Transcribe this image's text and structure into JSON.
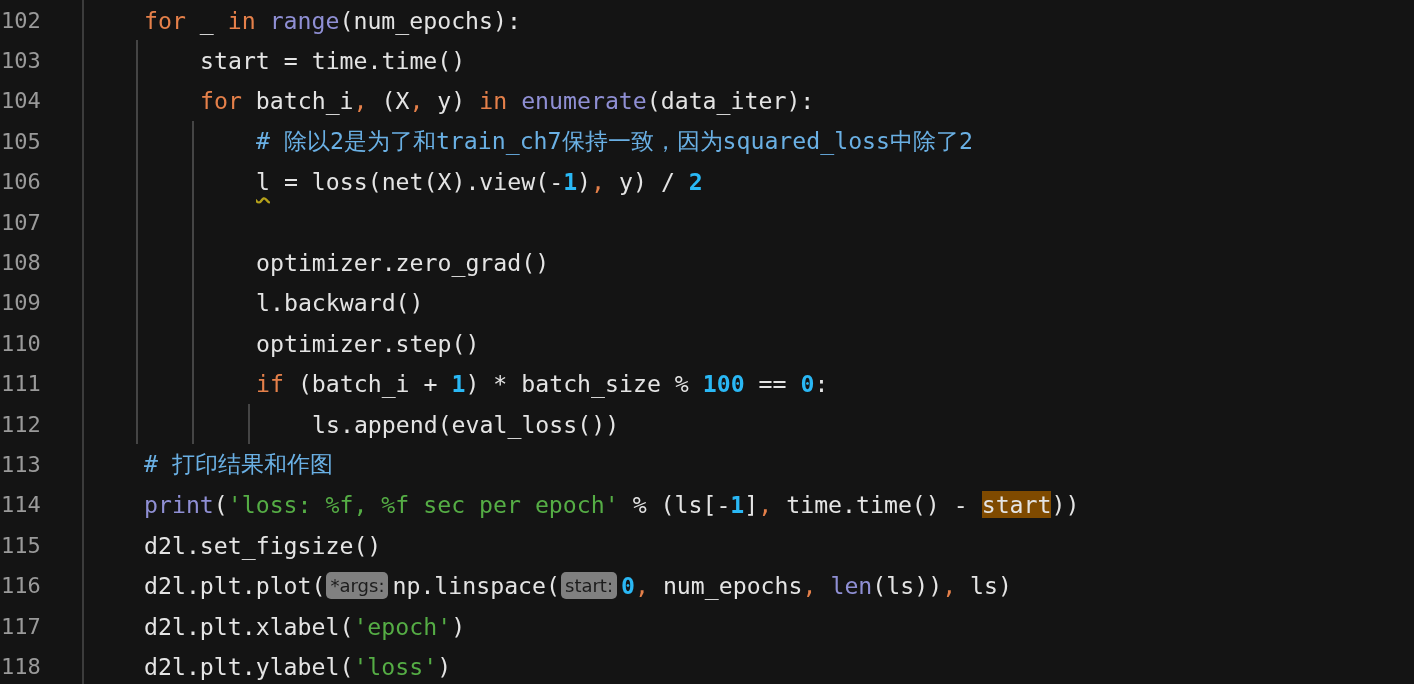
{
  "editor": {
    "lines": [
      {
        "number": "102",
        "tokens": [
          {
            "text": "for",
            "kind": "keyword"
          },
          {
            "text": " _ ",
            "kind": "plain"
          },
          {
            "text": "in",
            "kind": "keyword"
          },
          {
            "text": " range",
            "kind": "builtin"
          },
          {
            "text": "(num_epochs):",
            "kind": "plain"
          }
        ],
        "children": [
          {
            "number": "103",
            "tokens": [
              {
                "text": "start = time.time()",
                "kind": "plain"
              }
            ]
          },
          {
            "number": "104",
            "tokens": [
              {
                "text": "for",
                "kind": "keyword"
              },
              {
                "text": " batch_i",
                "kind": "plain"
              },
              {
                "text": ",",
                "kind": "punct"
              },
              {
                "text": " (X",
                "kind": "plain"
              },
              {
                "text": ",",
                "kind": "punct"
              },
              {
                "text": " y) ",
                "kind": "plain"
              },
              {
                "text": "in",
                "kind": "keyword"
              },
              {
                "text": " enumerate",
                "kind": "builtin"
              },
              {
                "text": "(data_iter):",
                "kind": "plain"
              }
            ],
            "children": [
              {
                "number": "105",
                "tokens": [
                  {
                    "text": "# 除以2是为了和train_ch7保持一致，因为squared_loss中除了2",
                    "kind": "comment"
                  }
                ]
              },
              {
                "number": "106",
                "tokens": [
                  {
                    "text": "l",
                    "kind": "warned"
                  },
                  {
                    "text": " = loss(net(X).view(-",
                    "kind": "plain"
                  },
                  {
                    "text": "1",
                    "kind": "number"
                  },
                  {
                    "text": ")",
                    "kind": "plain"
                  },
                  {
                    "text": ",",
                    "kind": "punct"
                  },
                  {
                    "text": " y) / ",
                    "kind": "plain"
                  },
                  {
                    "text": "2",
                    "kind": "number"
                  }
                ]
              },
              {
                "number": "107"
              },
              {
                "number": "108",
                "tokens": [
                  {
                    "text": "optimizer.zero_grad()",
                    "kind": "plain"
                  }
                ]
              },
              {
                "number": "109",
                "tokens": [
                  {
                    "text": "l.backward()",
                    "kind": "plain"
                  }
                ]
              },
              {
                "number": "110",
                "tokens": [
                  {
                    "text": "optimizer.step()",
                    "kind": "plain"
                  }
                ]
              },
              {
                "number": "111",
                "tokens": [
                  {
                    "text": "if",
                    "kind": "keyword"
                  },
                  {
                    "text": " (batch_i + ",
                    "kind": "plain"
                  },
                  {
                    "text": "1",
                    "kind": "number"
                  },
                  {
                    "text": ") * batch_size % ",
                    "kind": "plain"
                  },
                  {
                    "text": "100",
                    "kind": "number"
                  },
                  {
                    "text": " == ",
                    "kind": "plain"
                  },
                  {
                    "text": "0",
                    "kind": "number"
                  },
                  {
                    "text": ":",
                    "kind": "plain"
                  }
                ],
                "children": [
                  {
                    "number": "112",
                    "tokens": [
                      {
                        "text": "ls.append(eval_loss())",
                        "kind": "plain"
                      }
                    ]
                  }
                ]
              }
            ]
          }
        ]
      },
      {
        "number": "113",
        "tokens": [
          {
            "text": "# 打印结果和作图",
            "kind": "comment"
          }
        ]
      },
      {
        "number": "114",
        "tokens": [
          {
            "text": "print",
            "kind": "builtin"
          },
          {
            "text": "(",
            "kind": "plain"
          },
          {
            "text": "'loss: %f, %f sec per epoch'",
            "kind": "string"
          },
          {
            "text": " % (ls[-",
            "kind": "plain"
          },
          {
            "text": "1",
            "kind": "number"
          },
          {
            "text": "]",
            "kind": "plain"
          },
          {
            "text": ",",
            "kind": "punct"
          },
          {
            "text": " time.time() - ",
            "kind": "plain"
          },
          {
            "text": "start",
            "kind": "match"
          },
          {
            "text": "))",
            "kind": "plain"
          }
        ]
      },
      {
        "number": "115",
        "tokens": [
          {
            "text": "d2l.set_figsize()",
            "kind": "plain"
          }
        ]
      },
      {
        "number": "116",
        "tokens": [
          {
            "text": "d2l.plt.plot(",
            "kind": "plain"
          },
          {
            "text": "*args:",
            "kind": "hint"
          },
          {
            "text": "np.linspace(",
            "kind": "plain"
          },
          {
            "text": "start:",
            "kind": "hint"
          },
          {
            "text": "0",
            "kind": "number"
          },
          {
            "text": ",",
            "kind": "punct"
          },
          {
            "text": " num_epochs",
            "kind": "plain"
          },
          {
            "text": ",",
            "kind": "punct"
          },
          {
            "text": " len",
            "kind": "builtin"
          },
          {
            "text": "(ls))",
            "kind": "plain"
          },
          {
            "text": ",",
            "kind": "punct"
          },
          {
            "text": " ls)",
            "kind": "plain"
          }
        ]
      },
      {
        "number": "117",
        "tokens": [
          {
            "text": "d2l.plt.xlabel(",
            "kind": "plain"
          },
          {
            "text": "'epoch'",
            "kind": "string"
          },
          {
            "text": ")",
            "kind": "plain"
          }
        ]
      },
      {
        "number": "118",
        "tokens": [
          {
            "text": "d2l.plt.ylabel(",
            "kind": "plain"
          },
          {
            "text": "'loss'",
            "kind": "string"
          },
          {
            "text": ")",
            "kind": "plain"
          }
        ]
      }
    ]
  }
}
